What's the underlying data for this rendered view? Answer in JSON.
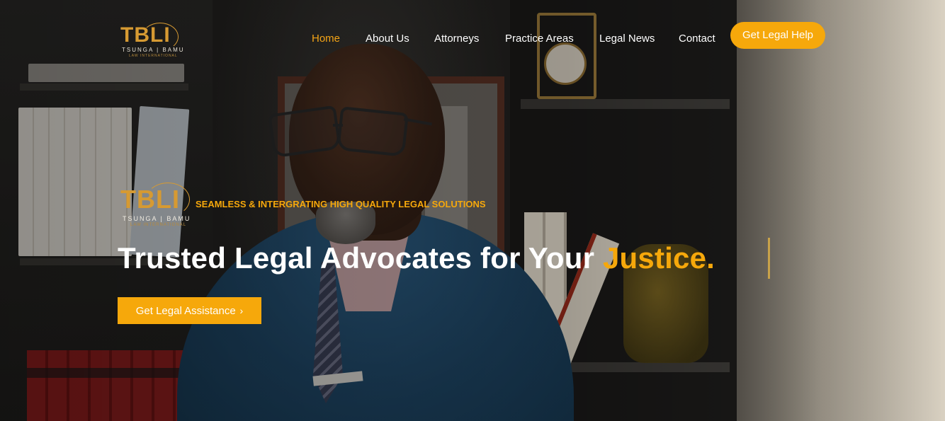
{
  "brand": {
    "logo_text": "TBLI",
    "logo_subtitle": "TSUNGA | BAMU",
    "logo_subtitle_2": "LAW INTERNATIONAL"
  },
  "nav": {
    "items": [
      {
        "label": "Home",
        "active": true
      },
      {
        "label": "About Us",
        "active": false
      },
      {
        "label": "Attorneys",
        "active": false
      },
      {
        "label": "Practice Areas",
        "active": false
      },
      {
        "label": "Legal News",
        "active": false
      },
      {
        "label": "Contact",
        "active": false
      }
    ],
    "cta_label": "Get Legal Help"
  },
  "hero": {
    "tagline": "SEAMLESS & INTERGRATING HIGH QUALITY LEGAL SOLUTIONS",
    "headline_main": "Trusted Legal Advocates for Your ",
    "headline_accent": "Justice.",
    "cta_label": "Get Legal Assistance",
    "cta_icon": "chevron-right-icon"
  },
  "colors": {
    "accent": "#f6a80b",
    "logo_gold": "#d69a32",
    "text_light": "#ffffff"
  }
}
